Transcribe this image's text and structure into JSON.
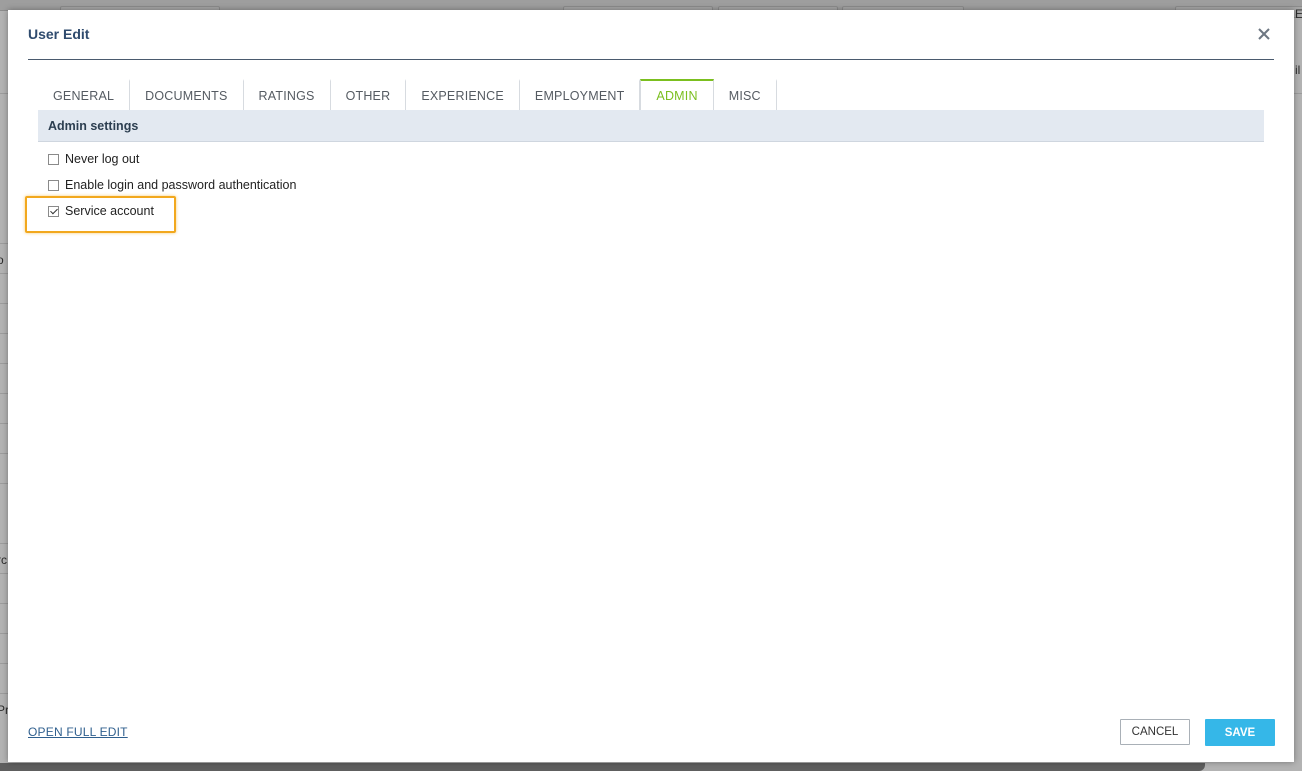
{
  "background": {
    "fragments": [
      "o",
      "rc",
      "Pr",
      "il",
      "E"
    ]
  },
  "modal": {
    "title": "User Edit",
    "close_icon": "close-icon"
  },
  "tabs": [
    {
      "label": "GENERAL",
      "active": false
    },
    {
      "label": "DOCUMENTS",
      "active": false
    },
    {
      "label": "RATINGS",
      "active": false
    },
    {
      "label": "OTHER",
      "active": false
    },
    {
      "label": "EXPERIENCE",
      "active": false
    },
    {
      "label": "EMPLOYMENT",
      "active": false
    },
    {
      "label": "ADMIN",
      "active": true
    },
    {
      "label": "MISC",
      "active": false
    }
  ],
  "admin_settings": {
    "title": "Admin settings",
    "options": [
      {
        "label": "Never log out",
        "checked": false
      },
      {
        "label": "Enable login and password authentication",
        "checked": false
      },
      {
        "label": "Service account",
        "checked": true
      }
    ]
  },
  "footer": {
    "open_full_edit": "OPEN FULL EDIT",
    "cancel_label": "CANCEL",
    "save_label": "SAVE"
  },
  "colors": {
    "accent_tab": "#7bbf1f",
    "save_button": "#35b7e8",
    "highlight": "#f2a81d",
    "title": "#2f4b6e"
  }
}
